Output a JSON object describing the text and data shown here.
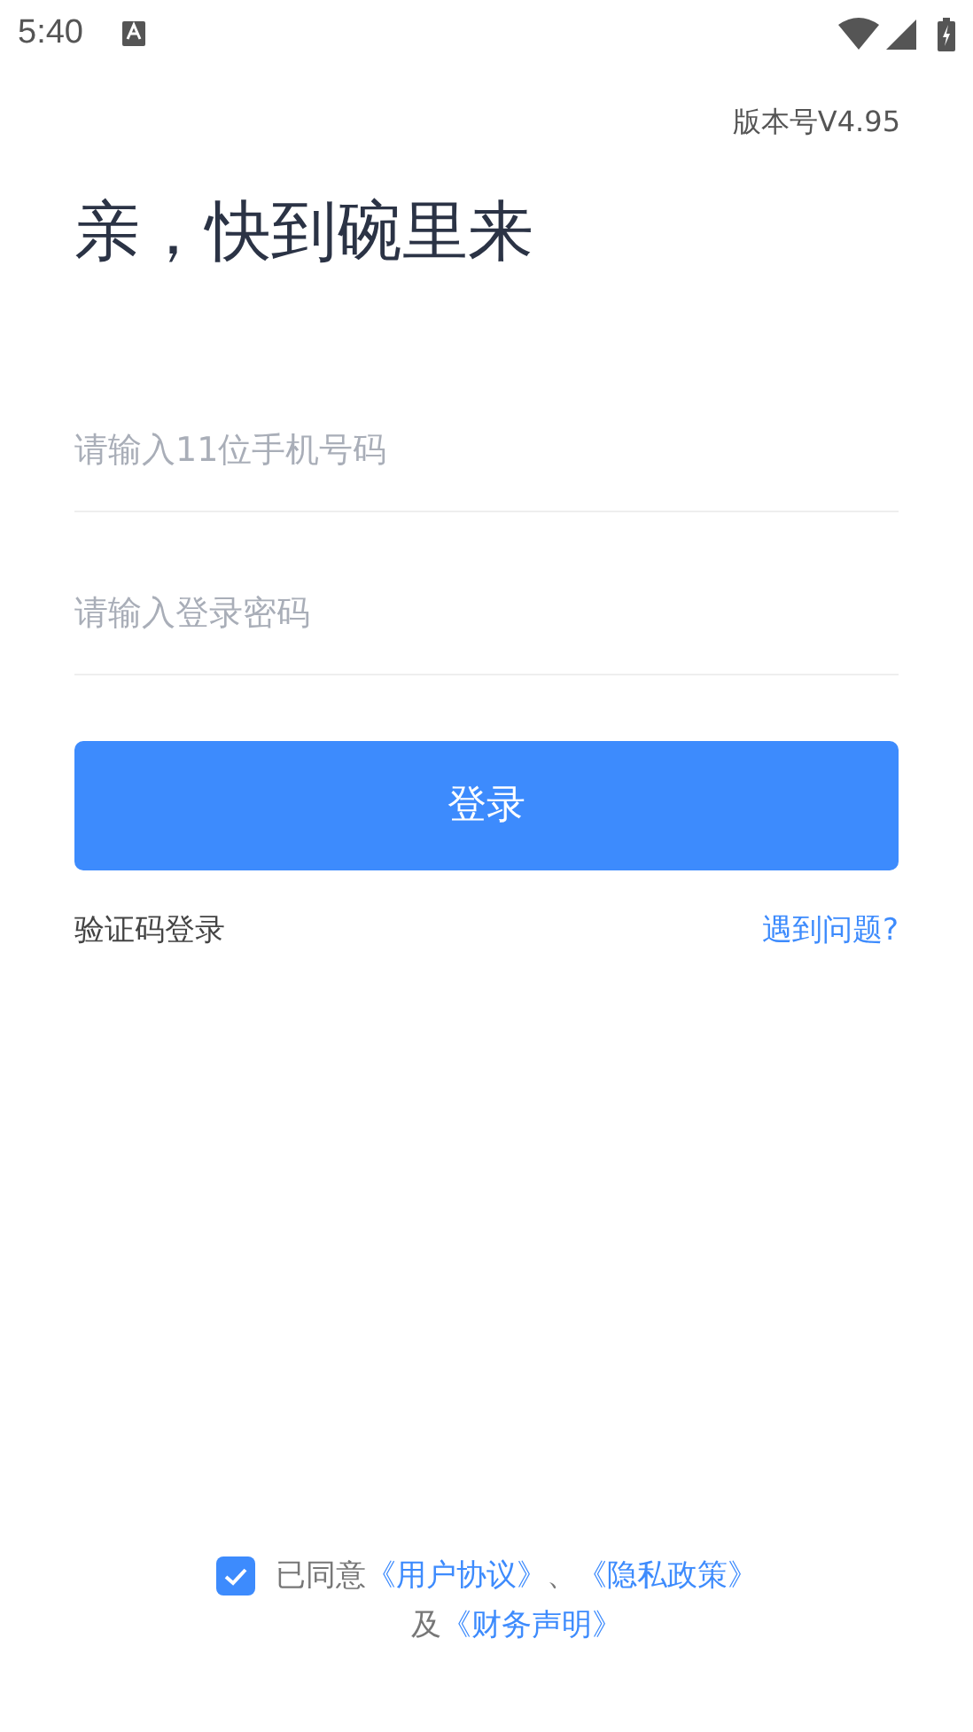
{
  "status_bar": {
    "time": "5:40"
  },
  "version": "版本号V4.95",
  "title": "亲，快到碗里来",
  "phone_field": {
    "placeholder": "请输入11位手机号码"
  },
  "password_field": {
    "placeholder": "请输入登录密码"
  },
  "login_button": "登录",
  "sms_login_link": "验证码登录",
  "help_link": "遇到问题?",
  "agreement": {
    "checked": true,
    "parts": [
      {
        "kind": "text",
        "text": "已同意"
      },
      {
        "kind": "link",
        "text": "《用户协议》"
      },
      {
        "kind": "text",
        "text": "、"
      },
      {
        "kind": "link",
        "text": "《隐私政策》"
      },
      {
        "kind": "text",
        "text": "及"
      },
      {
        "kind": "link",
        "text": "《财务声明》"
      }
    ]
  }
}
